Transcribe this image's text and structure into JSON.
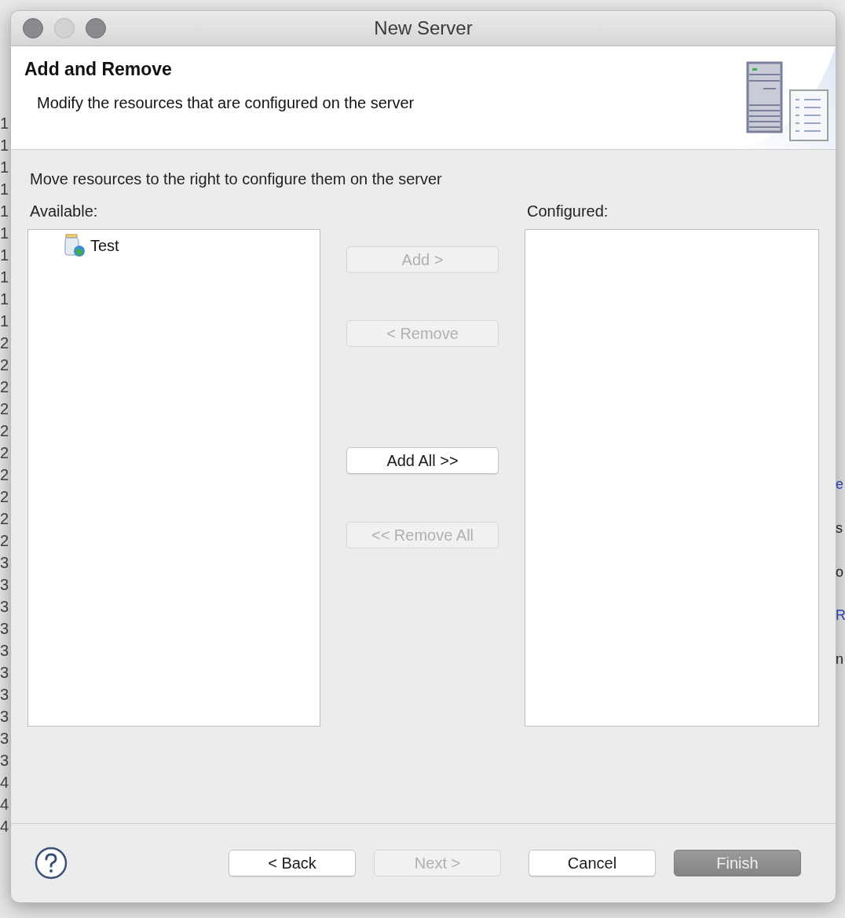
{
  "background_window": {
    "line_numbers": [
      "1",
      "1",
      "1",
      "1",
      "1",
      "1",
      "1",
      "1",
      "1",
      "1",
      "2",
      "2",
      "2",
      "2",
      "2",
      "2",
      "2",
      "2",
      "2",
      "2",
      "3",
      "3",
      "3",
      "3",
      "3",
      "3",
      "3",
      "3",
      "3",
      "3",
      "4",
      "4",
      "4"
    ],
    "editor_fragments": [
      {
        "text": "e",
        "kind": "link"
      },
      {
        "text": "s",
        "kind": "plain"
      },
      {
        "text": "o",
        "kind": "plain"
      },
      {
        "text": "R",
        "kind": "link"
      },
      {
        "text": "n",
        "kind": "plain"
      }
    ]
  },
  "dialog": {
    "title": "New Server",
    "window_buttons": [
      {
        "disabled": false
      },
      {
        "disabled": true
      },
      {
        "disabled": false
      }
    ],
    "header": {
      "title": "Add and Remove",
      "description": "Modify the resources that are configured on the server"
    },
    "instruction": "Move resources to the right to configure them on the server",
    "available": {
      "label": "Available:",
      "items": [
        {
          "label": "Test",
          "selected": false
        }
      ]
    },
    "configured": {
      "label": "Configured:"
    },
    "move_buttons": [
      {
        "label": "Add >",
        "disabled": true
      },
      {
        "label": "< Remove",
        "disabled": true
      },
      {
        "label": "Add All >>",
        "disabled": false
      },
      {
        "label": "<< Remove All",
        "disabled": true
      }
    ],
    "footer_buttons": [
      {
        "label": "< Back",
        "disabled": false,
        "default": false
      },
      {
        "label": "Next >",
        "disabled": true,
        "default": false
      },
      {
        "label": "Cancel",
        "disabled": false,
        "default": false
      },
      {
        "label": "Finish",
        "disabled": true,
        "default": true
      }
    ]
  }
}
